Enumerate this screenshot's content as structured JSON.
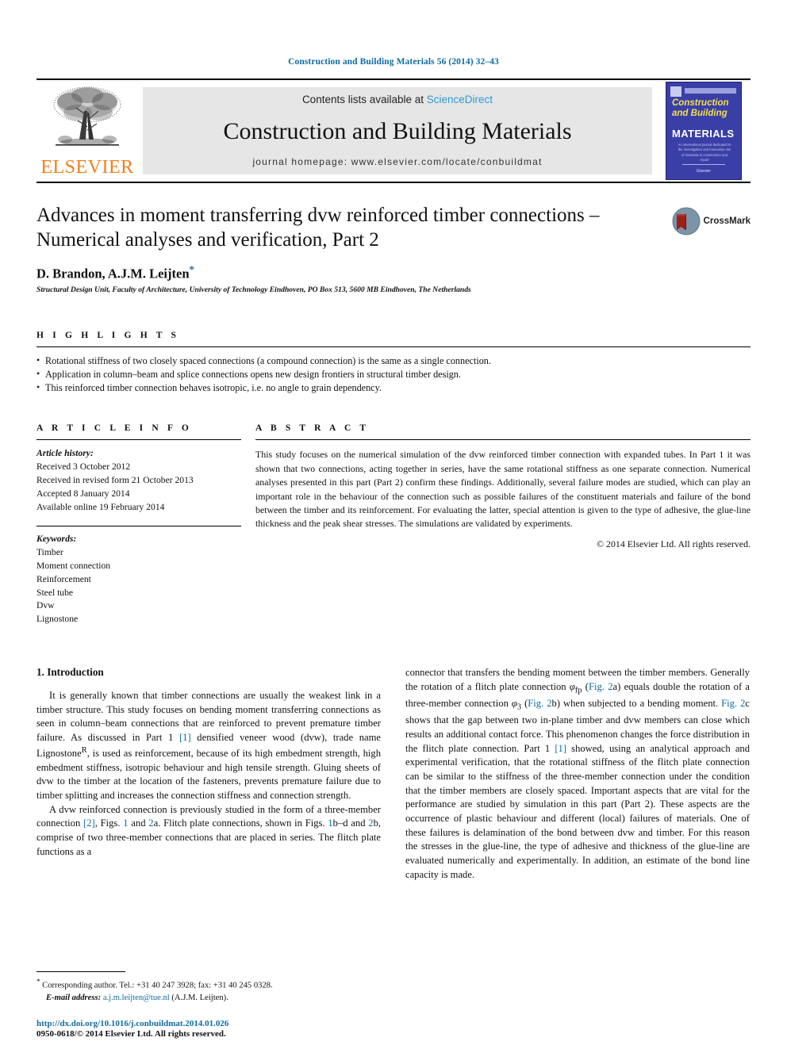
{
  "running_head": "Construction and Building Materials 56 (2014) 32–43",
  "masthead": {
    "publisher_name": "ELSEVIER",
    "contents_prefix": "Contents lists available at ",
    "contents_link": "ScienceDirect",
    "journal_name": "Construction and Building Materials",
    "homepage": "journal homepage: www.elsevier.com/locate/conbuildmat",
    "cover": {
      "line1": "Construction",
      "line2": "and Building",
      "line3": "MATERIALS",
      "subtitle": "An international journal dedicated to the investigation and innovative use of materials in construction and repair",
      "footer": "Elsevier"
    }
  },
  "article": {
    "title": "Advances in moment transferring dvw reinforced timber connections – Numerical analyses and verification, Part 2",
    "authors": "D. Brandon, A.J.M. Leijten",
    "corresponding_marker": "*",
    "affiliation": "Structural Design Unit, Faculty of Architecture, University of Technology Eindhoven, PO Box 513, 5600 MB Eindhoven, The Netherlands",
    "crossmark_label": "CrossMark"
  },
  "highlights": {
    "heading": "H I G H L I G H T S",
    "items": [
      "Rotational stiffness of two closely spaced connections (a compound connection) is the same as a single connection.",
      "Application in column–beam and splice connections opens new design frontiers in structural timber design.",
      "This reinforced timber connection behaves isotropic, i.e. no angle to grain dependency."
    ]
  },
  "article_info": {
    "heading": "A R T I C L E    I N F O",
    "history_label": "Article history:",
    "history": [
      "Received 3 October 2012",
      "Received in revised form 21 October 2013",
      "Accepted 8 January 2014",
      "Available online 19 February 2014"
    ],
    "keywords_label": "Keywords:",
    "keywords": [
      "Timber",
      "Moment connection",
      "Reinforcement",
      "Steel tube",
      "Dvw",
      "Lignostone"
    ]
  },
  "abstract": {
    "heading": "A B S T R A C T",
    "text": "This study focuses on the numerical simulation of the dvw reinforced timber connection with expanded tubes. In Part 1 it was shown that two connections, acting together in series, have the same rotational stiffness as one separate connection. Numerical analyses presented in this part (Part 2) confirm these findings. Additionally, several failure modes are studied, which can play an important role in the behaviour of the connection such as possible failures of the constituent materials and failure of the bond between the timber and its reinforcement. For evaluating the latter, special attention is given to the type of adhesive, the glue-line thickness and the peak shear stresses. The simulations are validated by experiments.",
    "rights": "© 2014 Elsevier Ltd. All rights reserved."
  },
  "body": {
    "section_title": "1. Introduction",
    "left_paragraph_1_a": "It is generally known that timber connections are usually the weakest link in a timber structure. This study focuses on bending moment transferring connections as seen in column–beam connections that are reinforced to prevent premature timber failure. As discussed in Part 1 ",
    "left_p1_ref1": "[1]",
    "left_paragraph_1_b": " densified veneer wood (dvw), trade name Lignostone",
    "left_p1_sup": "R",
    "left_paragraph_1_c": ", is used as reinforcement, because of its high embedment strength, high embedment stiffness, isotropic behaviour and high tensile strength. Gluing sheets of dvw to the timber at the location of the fasteners, prevents premature failure due to timber splitting and increases the connection stiffness and connection strength.",
    "left_paragraph_2_a": "A dvw reinforced connection is previously studied in the form of a three-member connection ",
    "left_p2_ref1": "[2]",
    "left_paragraph_2_b": ", Figs. ",
    "left_p2_ref2": "1",
    "left_paragraph_2_c": " and ",
    "left_p2_ref3": "2",
    "left_paragraph_2_d": "a. Flitch plate connections, shown in Figs. ",
    "left_p2_ref4": "1",
    "left_paragraph_2_e": "b–d and ",
    "left_p2_ref5": "2",
    "left_paragraph_2_f": "b, comprise of two three-member connections that are placed in series. The flitch plate functions as a",
    "right_paragraph_a": "connector that transfers the bending moment between the timber members. Generally the rotation of a flitch plate connection ",
    "right_phi_fp": "φ",
    "right_phi_fp_sub": "fp",
    "right_paragraph_b": " (",
    "right_ref1": "Fig. 2",
    "right_paragraph_c": "a) equals double the rotation of a three-member connection ",
    "right_phi_3": "φ",
    "right_phi_3_sub": "3",
    "right_paragraph_d": " (",
    "right_ref2": "Fig. 2",
    "right_paragraph_e": "b) when subjected to a bending moment. ",
    "right_ref3": "Fig. 2",
    "right_paragraph_f": "c shows that the gap between two in-plane timber and dvw members can close which results an additional contact force. This phenomenon changes the force distribution in the flitch plate connection. Part 1 ",
    "right_ref4": "[1]",
    "right_paragraph_g": " showed, using an analytical approach and experimental verification, that the rotational stiffness of the flitch plate connection can be similar to the stiffness of the three-member connection under the condition that the timber members are closely spaced. Important aspects that are vital for the performance are studied by simulation in this part (Part 2). These aspects are the occurrence of plastic behaviour and different (local) failures of materials. One of these failures is delamination of the bond between dvw and timber. For this reason the stresses in the glue-line, the type of adhesive and thickness of the glue-line are evaluated numerically and experimentally. In addition, an estimate of the bond line capacity is made."
  },
  "footnote": {
    "star": "*",
    "corresponding": " Corresponding author. Tel.: +31 40 247 3928; fax: +31 40 245 0328.",
    "email_label": "E-mail address:",
    "email": "a.j.m.leijten@tue.nl",
    "email_suffix": " (A.J.M. Leijten)."
  },
  "footer": {
    "doi": "http://dx.doi.org/10.1016/j.conbuildmat.2014.01.026",
    "issn": "0950-0618/© 2014 Elsevier Ltd. All rights reserved."
  },
  "colors": {
    "link_blue": "#0f6ba0",
    "sciencedirect_blue": "#2f9ad0",
    "elsevier_orange": "#F07F1A",
    "cover_blue": "#3a3fa8"
  }
}
